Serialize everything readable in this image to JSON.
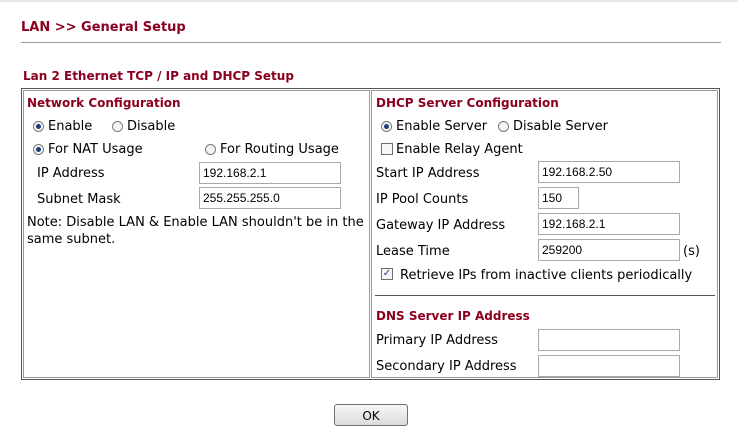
{
  "page": {
    "title": "LAN >> General Setup",
    "section_title": "Lan 2 Ethernet TCP / IP and DHCP Setup"
  },
  "network": {
    "heading": "Network Configuration",
    "enable_label": "Enable",
    "disable_label": "Disable",
    "enabled": true,
    "nat_label": "For NAT Usage",
    "routing_label": "For Routing Usage",
    "usage": "nat",
    "ip_label": "IP Address",
    "ip_value": "192.168.2.1",
    "mask_label": "Subnet Mask",
    "mask_value": "255.255.255.0",
    "note": "Note: Disable LAN & Enable LAN shouldn't be in the same subnet."
  },
  "dhcp": {
    "heading": "DHCP Server Configuration",
    "enable_server_label": "Enable Server",
    "disable_server_label": "Disable Server",
    "server_enabled": true,
    "relay_label": "Enable Relay Agent",
    "relay_checked": false,
    "start_ip_label": "Start IP Address",
    "start_ip_value": "192.168.2.50",
    "pool_label": "IP Pool Counts",
    "pool_value": "150",
    "gateway_label": "Gateway IP Address",
    "gateway_value": "192.168.2.1",
    "lease_label": "Lease Time",
    "lease_value": "259200",
    "lease_unit": "(s)",
    "retrieve_label": "Retrieve IPs from inactive clients periodically",
    "retrieve_checked": true
  },
  "dns": {
    "heading": "DNS Server IP Address",
    "primary_label": "Primary IP Address",
    "primary_value": "",
    "secondary_label": "Secondary IP Address",
    "secondary_value": ""
  },
  "buttons": {
    "ok_label": "OK"
  },
  "colors": {
    "heading": "#8b0020"
  }
}
